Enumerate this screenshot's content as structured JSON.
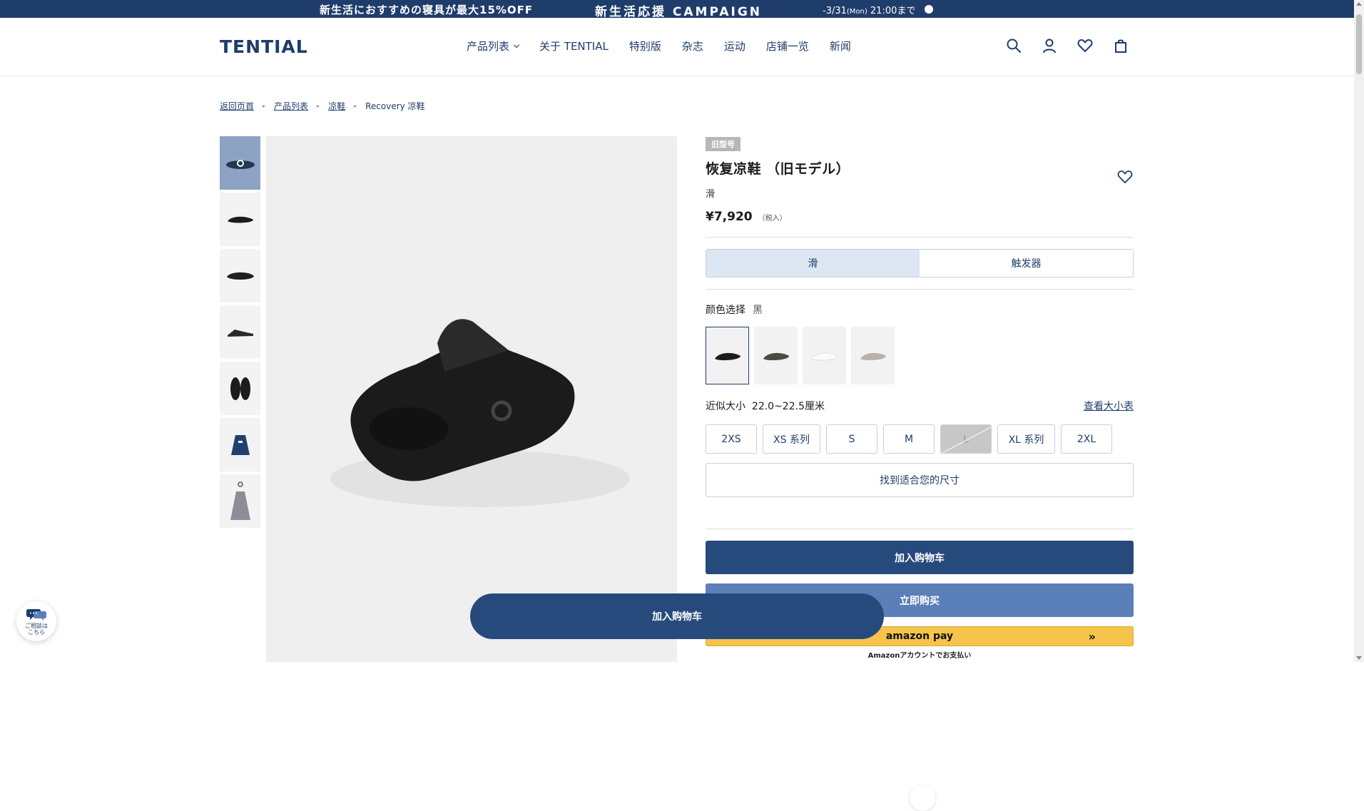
{
  "banner": {
    "promo_text": "新生活におすすめの寝具が最大15%OFF",
    "campaign_text": "新生活応援 CAMPAIGN",
    "deadline_date": "-3/31",
    "deadline_day": "(Mon)",
    "deadline_time": " 21:00まで"
  },
  "header": {
    "logo": "TENTIAL",
    "nav": [
      "产品列表",
      "关于 TENTIAL",
      "特别版",
      "杂志",
      "运动",
      "店铺一览",
      "新闻"
    ],
    "icons": [
      "search-icon",
      "account-icon",
      "heart-icon",
      "cart-icon"
    ]
  },
  "breadcrumb": {
    "items": [
      "返回页首",
      "产品列表",
      "凉鞋"
    ],
    "current": "Recovery 凉鞋"
  },
  "gallery": {
    "thumbnails": [
      "logo-top-view",
      "side-view",
      "side-view-2",
      "profile-view",
      "top-pair-view",
      "navy-bag",
      "gray-bag"
    ],
    "next_icon": "plus-icon"
  },
  "product": {
    "tag": "旧型号",
    "title": "恢复凉鞋 （旧モデル）",
    "subtitle": "滑",
    "price": "¥7,920",
    "price_tax": "（税入）",
    "type_options": [
      "滑",
      "触发器"
    ],
    "selected_type_index": 0,
    "color_label": "颜色选择",
    "color_value": "黑",
    "colors": [
      {
        "name": "black",
        "hex": "#1c1c1c"
      },
      {
        "name": "olive",
        "hex": "#4a4c40"
      },
      {
        "name": "white",
        "hex": "#f6f6f6"
      },
      {
        "name": "beige",
        "hex": "#b9b1a5"
      }
    ],
    "size_label": "近似大小",
    "size_value": "22.0~22.5厘米",
    "size_chart_link": "查看大小表",
    "sizes": [
      {
        "label": "2XS",
        "disabled": false
      },
      {
        "label": "XS 系列",
        "disabled": false
      },
      {
        "label": "S",
        "disabled": false
      },
      {
        "label": "M",
        "disabled": false
      },
      {
        "label": "L",
        "disabled": true
      },
      {
        "label": "XL 系列",
        "disabled": false
      },
      {
        "label": "2XL",
        "disabled": false
      }
    ],
    "find_size_button": "找到适合您的尺寸",
    "add_to_cart": "加入购物车",
    "buy_now": "立即购买",
    "amazon_pay": "amazon pay",
    "amazon_note": "Amazonアカウントでお支払い"
  },
  "floating": {
    "cart_button": "加入购物车"
  },
  "chat": {
    "label_line1": "ご相談は",
    "label_line2": "こちら"
  },
  "colors": {
    "brand_navy": "#1f3d6b",
    "cart_blue": "#274a7c",
    "buy_now_blue": "#5b7fb9",
    "amazon_yellow": "#f5c44b"
  }
}
